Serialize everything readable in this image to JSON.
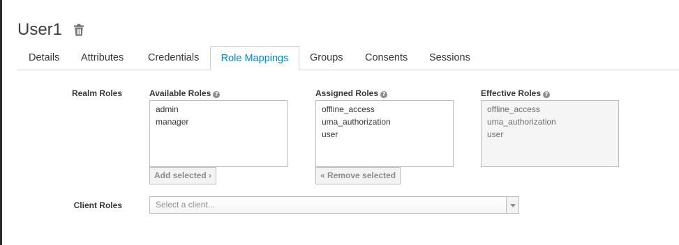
{
  "user": {
    "name": "User1",
    "delete_icon": "trash-icon"
  },
  "tabs": [
    {
      "label": "Details"
    },
    {
      "label": "Attributes"
    },
    {
      "label": "Credentials"
    },
    {
      "label": "Role Mappings",
      "active": true
    },
    {
      "label": "Groups"
    },
    {
      "label": "Consents"
    },
    {
      "label": "Sessions"
    }
  ],
  "realm_roles": {
    "label": "Realm Roles",
    "available": {
      "label": "Available Roles",
      "items": [
        "admin",
        "manager"
      ],
      "button": "Add selected ›"
    },
    "assigned": {
      "label": "Assigned Roles",
      "items": [
        "offline_access",
        "uma_authorization",
        "user"
      ],
      "button": "« Remove selected"
    },
    "effective": {
      "label": "Effective Roles",
      "items": [
        "offline_access",
        "uma_authorization",
        "user"
      ]
    }
  },
  "client_roles": {
    "label": "Client Roles",
    "placeholder": "Select a client..."
  },
  "colors": {
    "accent": "#0088ce",
    "border": "#d1d1d1",
    "text": "#363636"
  }
}
